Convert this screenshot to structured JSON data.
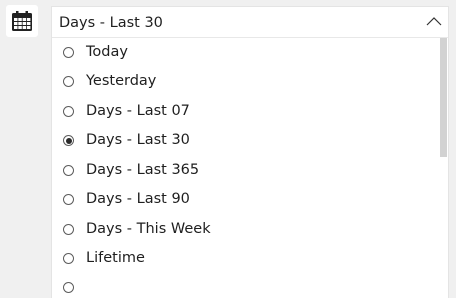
{
  "date_filter": {
    "calendar_icon": "calendar-icon",
    "selected_value": "Days - Last 30",
    "expanded": true,
    "chevron_icon": "chevron-up-icon",
    "options": [
      {
        "label": "Today",
        "checked": false
      },
      {
        "label": "Yesterday",
        "checked": false
      },
      {
        "label": "Days - Last 07",
        "checked": false
      },
      {
        "label": "Days - Last 30",
        "checked": true
      },
      {
        "label": "Days - Last 365",
        "checked": false
      },
      {
        "label": "Days - Last 90",
        "checked": false
      },
      {
        "label": "Days - This Week",
        "checked": false
      },
      {
        "label": "Lifetime",
        "checked": false
      }
    ]
  }
}
